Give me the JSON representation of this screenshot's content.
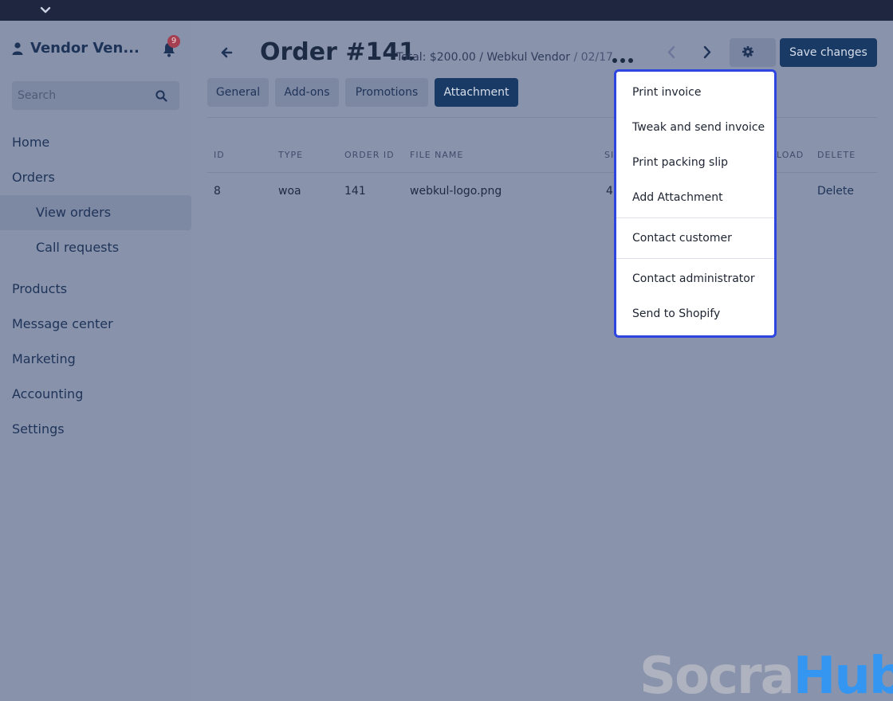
{
  "sidebar": {
    "vendor_name": "Vendor Ven...",
    "notification_count": "9",
    "search_placeholder": "Search",
    "nav": {
      "home": "Home",
      "orders": "Orders",
      "view_orders": "View orders",
      "call_requests": "Call requests",
      "products": "Products",
      "message_center": "Message center",
      "marketing": "Marketing",
      "accounting": "Accounting",
      "settings": "Settings"
    }
  },
  "header": {
    "title": "Order #141",
    "subtitle": "Total: $200.00 / Webkul Vendor",
    "date_fragment": "/ 02/17",
    "save_label": "Save changes"
  },
  "tabs": [
    {
      "label": "General"
    },
    {
      "label": "Add-ons"
    },
    {
      "label": "Promotions"
    },
    {
      "label": "Attachment",
      "active": true
    }
  ],
  "table": {
    "headers": {
      "id": "ID",
      "type": "TYPE",
      "order_id": "ORDER ID",
      "file_name": "FILE NAME",
      "size": "SI",
      "download": "LOAD",
      "delete": "DELETE"
    },
    "rows": [
      {
        "id": "8",
        "type": "woa",
        "order_id": "141",
        "file_name": "webkul-logo.png",
        "size": "4",
        "delete": "Delete"
      }
    ]
  },
  "dropdown": {
    "items": [
      "Print invoice",
      "Tweak and send invoice",
      "Print packing slip",
      "Add Attachment",
      "Contact customer",
      "Contact administrator",
      "Send to Shopify"
    ]
  },
  "watermark": {
    "part1": "Socra",
    "part2": "Hub"
  },
  "colors": {
    "accent": "#1a3a66",
    "dropdown_border": "#2f45e0",
    "badge": "#a43f52"
  },
  "icons": [
    "chevron-down-icon",
    "user-icon",
    "bell-icon",
    "search-icon",
    "back-arrow-icon",
    "more-icon",
    "chevron-left-icon",
    "chevron-right-icon",
    "gear-icon"
  ]
}
